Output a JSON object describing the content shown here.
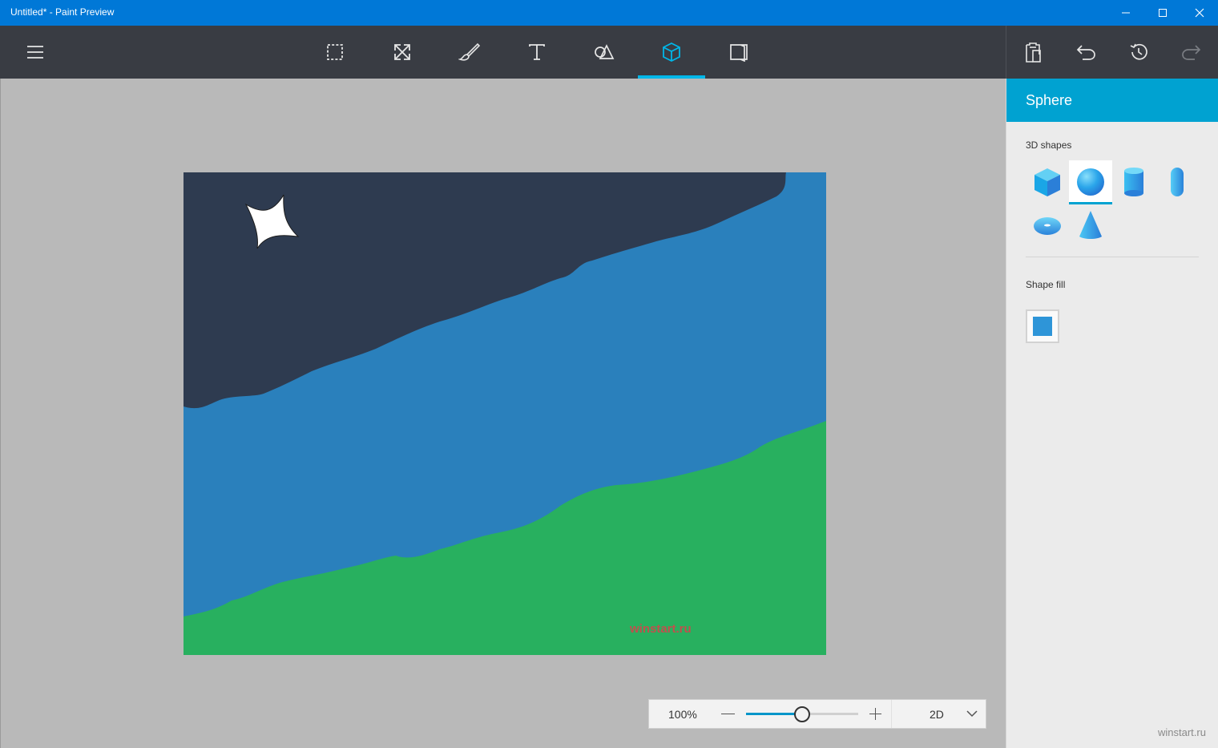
{
  "window": {
    "title": "Untitled* - Paint Preview",
    "controls": {
      "minimize": "minimize-icon",
      "maximize": "maximize-icon",
      "close": "close-icon"
    }
  },
  "toolbar": {
    "menu_icon": "hamburger-icon",
    "tools": [
      {
        "id": "select",
        "icon": "select-icon"
      },
      {
        "id": "crop",
        "icon": "resize-icon"
      },
      {
        "id": "brushes",
        "icon": "brush-icon"
      },
      {
        "id": "text",
        "icon": "text-icon"
      },
      {
        "id": "2d-shapes",
        "icon": "shapes-icon"
      },
      {
        "id": "3d-objects",
        "icon": "cube-icon",
        "active": true
      },
      {
        "id": "stickers",
        "icon": "book-icon"
      }
    ],
    "actions": [
      {
        "id": "paste",
        "icon": "paste-icon"
      },
      {
        "id": "undo",
        "icon": "undo-icon"
      },
      {
        "id": "history",
        "icon": "history-icon"
      },
      {
        "id": "redo",
        "icon": "redo-icon",
        "disabled": true
      }
    ]
  },
  "side_panel": {
    "title": "Sphere",
    "shapes_label": "3D shapes",
    "shapes": [
      {
        "name": "cube",
        "selected": false
      },
      {
        "name": "sphere",
        "selected": true
      },
      {
        "name": "cylinder",
        "selected": false
      },
      {
        "name": "capsule",
        "selected": false
      },
      {
        "name": "torus",
        "selected": false
      },
      {
        "name": "cone",
        "selected": false
      }
    ],
    "fill_label": "Shape fill",
    "fill_color": "#2e95d8"
  },
  "canvas": {
    "sky_color": "#2e3b50",
    "water_color": "#2a80bc",
    "grass_color": "#28b05f",
    "star_color": "#ffffff",
    "watermark": "winstart.ru"
  },
  "zoom": {
    "value": "100%",
    "level": 0.5,
    "mode": "2D"
  },
  "site_watermark": "winstart.ru",
  "colors": {
    "titlebar": "#0078d7",
    "toolbar": "#393c43",
    "accent": "#00a2d1"
  }
}
